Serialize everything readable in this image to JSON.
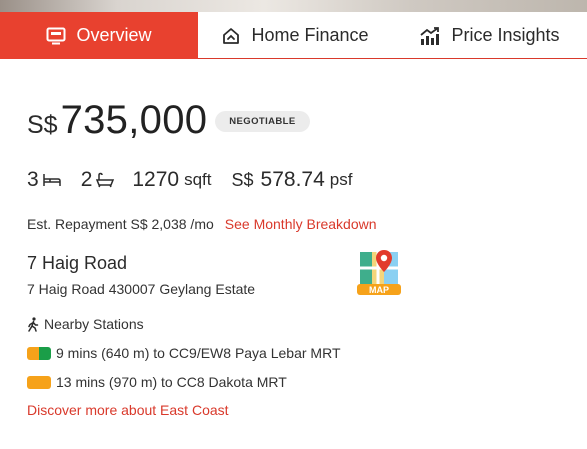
{
  "tabs": [
    {
      "label": "Overview",
      "icon": "overview-icon",
      "active": true
    },
    {
      "label": "Home Finance",
      "icon": "home-finance-icon",
      "active": false
    },
    {
      "label": "Price Insights",
      "icon": "chart-up-icon",
      "active": false
    }
  ],
  "price": {
    "currency": "S$",
    "amount": "735,000",
    "badge": "NEGOTIABLE"
  },
  "specs": {
    "bedrooms": "3",
    "bathrooms": "2",
    "size": "1270",
    "size_unit": "sqft",
    "psf_currency": "S$",
    "psf": "578.74",
    "psf_unit": "psf"
  },
  "repayment": {
    "text": "Est. Repayment S$ 2,038 /mo",
    "link": "See Monthly Breakdown"
  },
  "address": {
    "title": "7 Haig Road",
    "full": "7 Haig Road 430007 Geylang Estate",
    "map_label": "MAP"
  },
  "nearby": {
    "heading": "Nearby Stations",
    "stations": [
      {
        "text": "9 mins (640 m) to CC9/EW8 Paya Lebar MRT",
        "line_colors": [
          "#f6a21a",
          "#1a9e48"
        ]
      },
      {
        "text": "13 mins (970 m) to CC8 Dakota MRT",
        "line_colors": [
          "#f6a21a"
        ]
      }
    ]
  },
  "discover_link": "Discover more about East Coast",
  "colors": {
    "accent": "#e8412f",
    "link": "#d9392b",
    "circle_line": "#f6a21a",
    "ew_line": "#1a9e48"
  }
}
